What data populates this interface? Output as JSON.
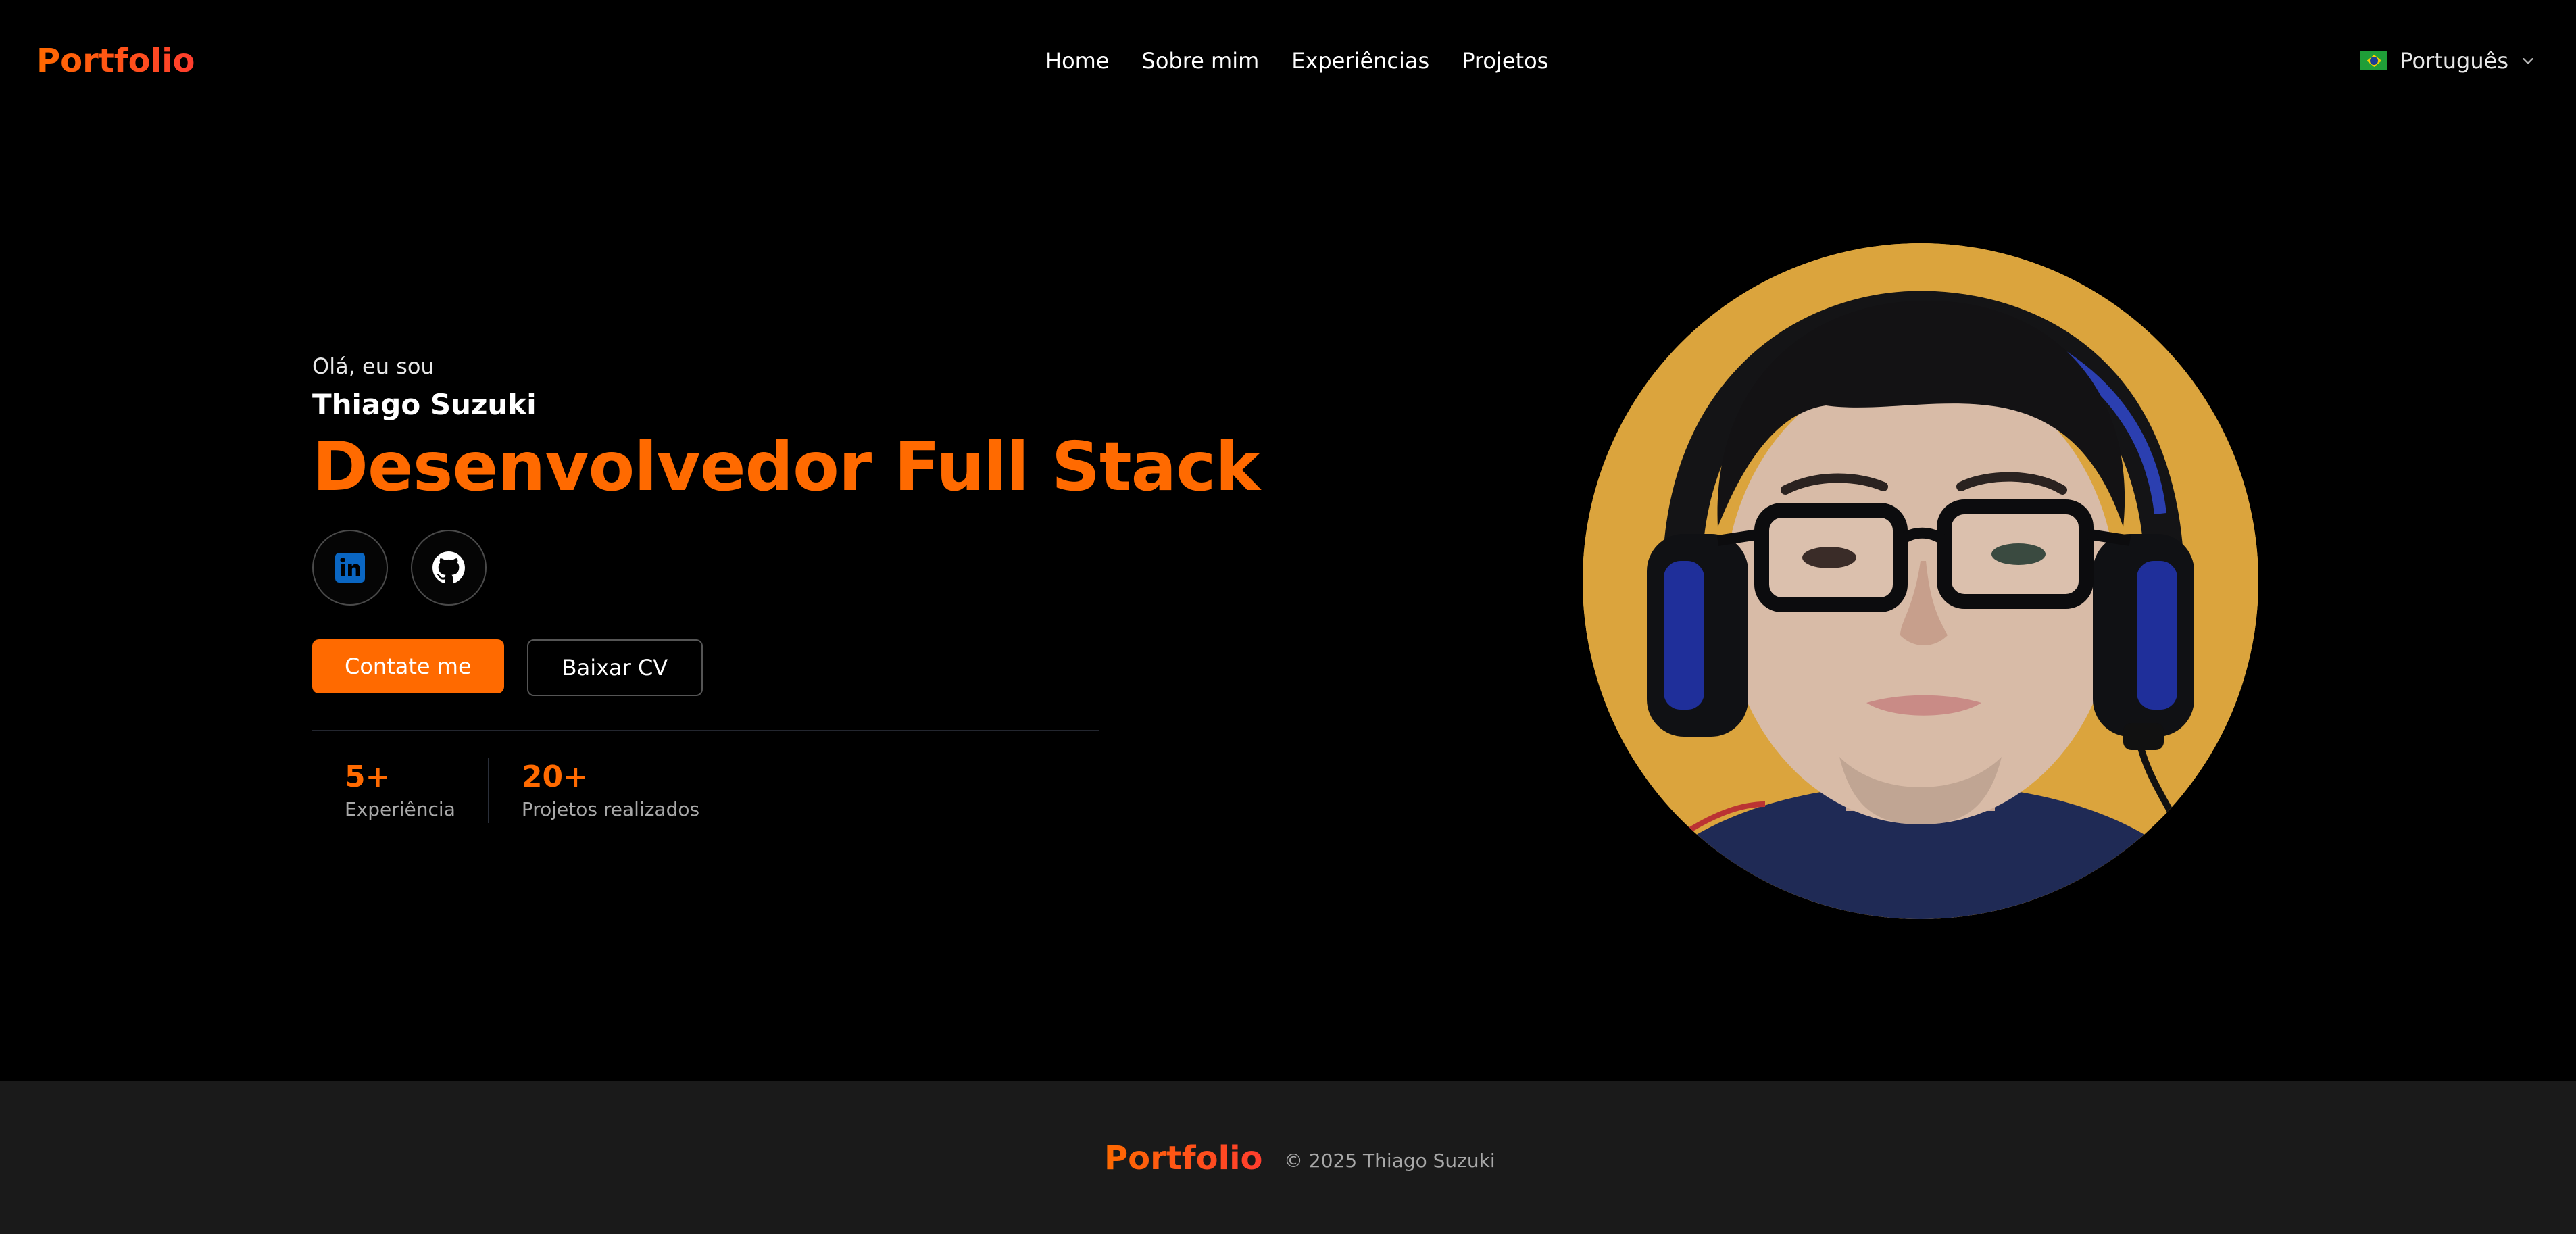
{
  "header": {
    "brand": "Portfolio",
    "nav": [
      "Home",
      "Sobre mim",
      "Experiências",
      "Projetos"
    ],
    "language": {
      "label": "Português",
      "flag_icon": "brazil-flag-icon"
    }
  },
  "hero": {
    "greeting": "Olá, eu sou",
    "name": "Thiago Suzuki",
    "role": "Desenvolvedor Full Stack",
    "socials": [
      {
        "name": "linkedin",
        "icon": "linkedin-icon",
        "color": "#0a66c2"
      },
      {
        "name": "github",
        "icon": "github-icon",
        "color": "#ffffff"
      }
    ],
    "buttons": {
      "primary_label": "Contate me",
      "secondary_label": "Baixar CV"
    },
    "stats": [
      {
        "value": "5+",
        "label": "Experiência"
      },
      {
        "value": "20+",
        "label": "Projetos realizados"
      }
    ],
    "avatar_alt": "Thiago Suzuki"
  },
  "footer": {
    "brand": "Portfolio",
    "copyright": "© 2025 Thiago Suzuki"
  },
  "colors": {
    "accent": "#ff6a00",
    "background": "#000000",
    "footer_background": "#1a1a1a",
    "avatar_background": "#d9a13a"
  }
}
